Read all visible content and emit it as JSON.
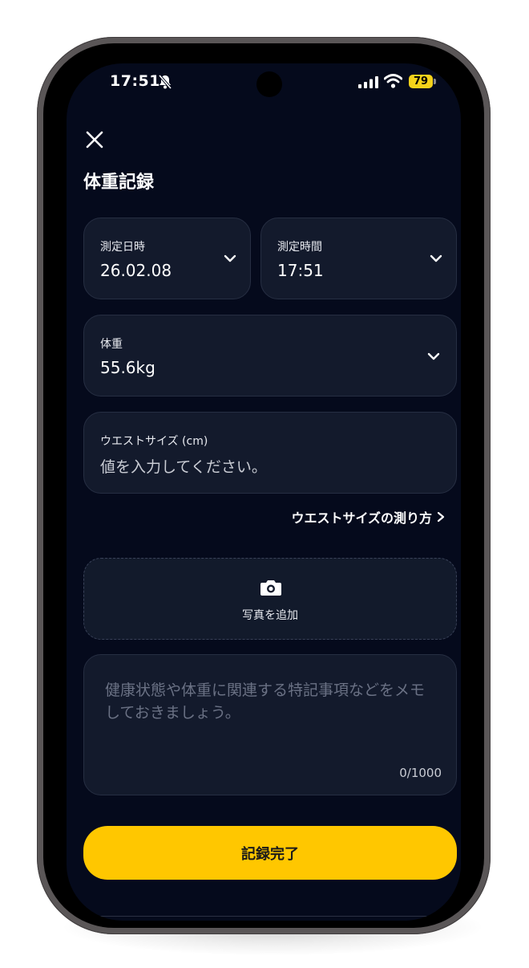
{
  "status_bar": {
    "time": "17:51",
    "battery": "79",
    "icons": [
      "bell-slash-icon",
      "signal-icon",
      "wifi-icon",
      "battery-icon"
    ]
  },
  "header": {
    "close_icon": "close-icon",
    "title": "体重記録"
  },
  "form": {
    "date": {
      "label": "測定日時",
      "value": "26.02.08"
    },
    "time": {
      "label": "測定時間",
      "value": "17:51"
    },
    "weight": {
      "label": "体重",
      "value": "55.6kg"
    },
    "waist": {
      "label": "ウエストサイズ (cm)",
      "placeholder": "値を入力してください。"
    },
    "waist_link": "ウエストサイズの測り方",
    "photo": {
      "icon": "camera-icon",
      "label": "写真を追加"
    },
    "memo": {
      "placeholder": "健康状態や体重に関連する特記事項などをメモしておきましょう。",
      "counter": "0/1000"
    }
  },
  "submit_label": "記録完了",
  "colors": {
    "background": "#050a1c",
    "card": "#131a2c",
    "accent": "#ffc700",
    "battery": "#f5d21a"
  }
}
